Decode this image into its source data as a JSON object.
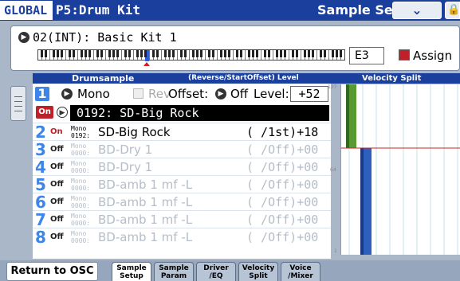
{
  "title": {
    "mode": "GLOBAL",
    "page": "P5:Drum Kit",
    "tab": "Sample Setup",
    "menu_icon": "chevron-down-icon",
    "lock_icon": "lock-icon"
  },
  "kit": {
    "name": "02(INT): Basic Kit 1",
    "key": "E3",
    "assign_label": "Assign"
  },
  "header": {
    "drumsample": "Drumsample",
    "reverse_offset_level": "(Reverse/StartOffset) Level",
    "velocity_split": "Velocity Split"
  },
  "row1": {
    "index": "1",
    "mono": "Mono",
    "rev": "Rev",
    "offset": "Offset:",
    "off": "Off",
    "level_label": "Level:",
    "level_value": "+52",
    "on": "On",
    "sample": "0192: SD-Big Rock"
  },
  "rows": [
    {
      "index": "2",
      "state": "On",
      "mono_top": "Mono",
      "mono_bottom": "0192:",
      "name": "SD-Big Rock",
      "value": "( /1st)+18",
      "dim": false
    },
    {
      "index": "3",
      "state": "Off",
      "mono_top": "Mono",
      "mono_bottom": "0000:",
      "name": "BD-Dry 1",
      "value": "( /Off)+00",
      "dim": true
    },
    {
      "index": "4",
      "state": "Off",
      "mono_top": "Mono",
      "mono_bottom": "0000:",
      "name": "BD-Dry 1",
      "value": "( /Off)+00",
      "dim": true
    },
    {
      "index": "5",
      "state": "Off",
      "mono_top": "Mono",
      "mono_bottom": "0000:",
      "name": "BD-amb 1 mf -L",
      "value": "( /Off)+00",
      "dim": true
    },
    {
      "index": "6",
      "state": "Off",
      "mono_top": "Mono",
      "mono_bottom": "0000:",
      "name": "BD-amb 1 mf -L",
      "value": "( /Off)+00",
      "dim": true
    },
    {
      "index": "7",
      "state": "Off",
      "mono_top": "Mono",
      "mono_bottom": "0000:",
      "name": "BD-amb 1 mf -L",
      "value": "( /Off)+00",
      "dim": true
    },
    {
      "index": "8",
      "state": "Off",
      "mono_top": "Mono",
      "mono_bottom": "0000:",
      "name": "BD-amb 1 mf -L",
      "value": "( /Off)+00",
      "dim": true
    }
  ],
  "velocity_axis": {
    "top": "127",
    "mid": "64",
    "bottom": "1"
  },
  "footer": {
    "return_label": "Return to OSC",
    "tabs": [
      {
        "line1": "Sample",
        "line2": "Setup",
        "active": true
      },
      {
        "line1": "Sample",
        "line2": "Param",
        "active": false
      },
      {
        "line1": "Driver",
        "line2": "/EQ",
        "active": false
      },
      {
        "line1": "Velocity",
        "line2": "Split",
        "active": false
      },
      {
        "line1": "Voice",
        "line2": "/Mixer",
        "active": false
      }
    ]
  },
  "colors": {
    "title_bar": "#1a3f9c",
    "accent_blue": "#3d86e8",
    "on_red": "#c0202a",
    "velocity_green": "#5a9a32",
    "velocity_blue": "#2d5fbf"
  }
}
